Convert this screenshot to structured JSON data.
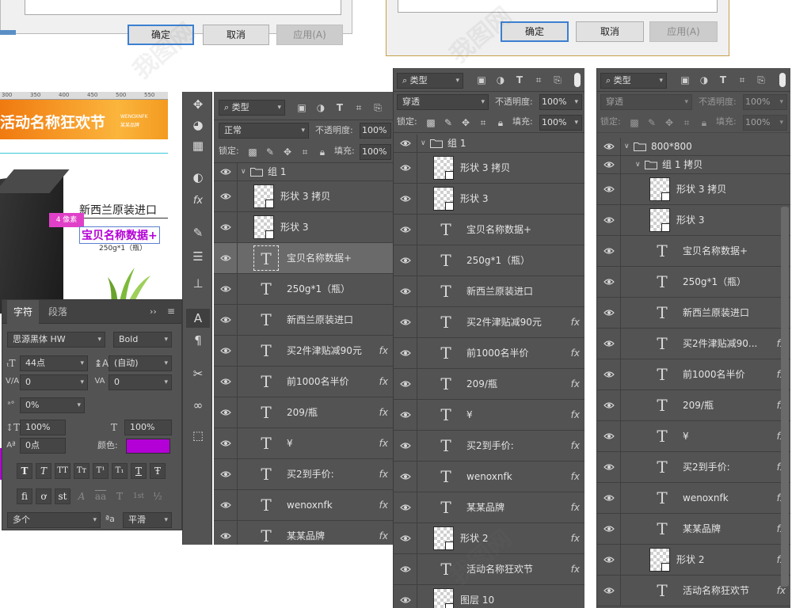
{
  "dialog_left": {
    "ok_label": "确定",
    "cancel_label": "取消",
    "apply_label": "应用(A)"
  },
  "dialog_right": {
    "ok_label": "确定",
    "cancel_label": "取消",
    "apply_label": "应用(A)"
  },
  "canvas": {
    "banner_title": "活动名称狂欢节",
    "brand_small": "WENOXNFK",
    "brand_small_cn": "某某品牌",
    "origin_text": "新西兰原装进口",
    "product_data": "宝贝名称数据+",
    "spec": "250g*1（瓶）",
    "pixel_badge": "4 像素",
    "ruler_marks": [
      "300",
      "350",
      "400",
      "450",
      "500",
      "550"
    ]
  },
  "tools": [
    "move-icon",
    "palette-icon",
    "grid-icon",
    "circle-half-icon",
    "fx-icon",
    "brush-adjust-icon",
    "sliders-icon",
    "stamp-icon",
    "type-a-icon",
    "paragraph-icon",
    "tools-icon",
    "cc-icon",
    "cube-icon"
  ],
  "character_panel": {
    "tab_character": "字符",
    "tab_paragraph": "段落",
    "font_family": "思源黑体 HW",
    "font_style": "Bold",
    "font_size": "44点",
    "leading": "(自动)",
    "kerning": "0",
    "tracking": "0",
    "scale_pct": "0%",
    "vertical_scale": "100%",
    "horizontal_scale": "100%",
    "baseline_shift": "0点",
    "color_label": "颜色:",
    "color_value": "#b300d6",
    "language": "多个",
    "aa_label": "ªa",
    "antialias": "平滑",
    "style_buttons": [
      "T",
      "T",
      "TT",
      "Tт",
      "T¹",
      "T₁",
      "T",
      "Ŧ"
    ],
    "ot_buttons": [
      "fi",
      "ơ",
      "st",
      "A",
      "aa",
      "T",
      "1st",
      "½"
    ]
  },
  "layers_panel_1": {
    "filter_kind": "类型",
    "blend_mode": "正常",
    "opacity_label": "不透明度:",
    "opacity": "100%",
    "lock_label": "锁定:",
    "fill_label": "填充:",
    "fill": "100%",
    "layers": [
      {
        "type": "group",
        "name": "组 1"
      },
      {
        "type": "shape",
        "name": "形状 3 拷贝"
      },
      {
        "type": "shape",
        "name": "形状 3"
      },
      {
        "type": "text",
        "name": "宝贝名称数据+",
        "selected": true
      },
      {
        "type": "text",
        "name": "250g*1（瓶）"
      },
      {
        "type": "text",
        "name": "新西兰原装进口"
      },
      {
        "type": "text",
        "name": "买2件津贴减90元",
        "fx": "fx"
      },
      {
        "type": "text",
        "name": "前1000名半价",
        "fx": "fx"
      },
      {
        "type": "text",
        "name": "209/瓶",
        "fx": "fx"
      },
      {
        "type": "text",
        "name": "¥",
        "fx": "fx"
      },
      {
        "type": "text",
        "name": "买2到手价:",
        "fx": "fx"
      },
      {
        "type": "text",
        "name": "wenoxnfk",
        "fx": "fx"
      },
      {
        "type": "text",
        "name": "某某品牌",
        "fx": "fx"
      }
    ]
  },
  "layers_panel_2": {
    "filter_kind": "类型",
    "blend_mode": "穿透",
    "opacity_label": "不透明度:",
    "opacity": "100%",
    "lock_label": "锁定:",
    "fill_label": "填充:",
    "fill": "100%",
    "layers": [
      {
        "type": "group",
        "name": "组 1"
      },
      {
        "type": "shape",
        "name": "形状 3 拷贝"
      },
      {
        "type": "shape",
        "name": "形状 3"
      },
      {
        "type": "text",
        "name": "宝贝名称数据+"
      },
      {
        "type": "text",
        "name": "250g*1（瓶）"
      },
      {
        "type": "text",
        "name": "新西兰原装进口"
      },
      {
        "type": "text",
        "name": "买2件津贴减90元",
        "fx": "fx"
      },
      {
        "type": "text",
        "name": "前1000名半价",
        "fx": "fx"
      },
      {
        "type": "text",
        "name": "209/瓶",
        "fx": "fx"
      },
      {
        "type": "text",
        "name": "¥",
        "fx": "fx"
      },
      {
        "type": "text",
        "name": "买2到手价:",
        "fx": "fx"
      },
      {
        "type": "text",
        "name": "wenoxnfk",
        "fx": "fx"
      },
      {
        "type": "text",
        "name": "某某品牌",
        "fx": "fx"
      },
      {
        "type": "shape",
        "name": "形状 2",
        "fx": "fx"
      },
      {
        "type": "text",
        "name": "活动名称狂欢节",
        "fx": "fx"
      },
      {
        "type": "shape",
        "name": "图层 10"
      }
    ]
  },
  "layers_panel_3": {
    "filter_kind": "类型",
    "blend_mode": "穿透",
    "opacity_label": "不透明度:",
    "opacity": "100%",
    "lock_label": "锁定:",
    "fill_label": "填充:",
    "fill": "100%",
    "layers": [
      {
        "type": "group",
        "name": "800*800"
      },
      {
        "type": "group",
        "name": "组 1 拷贝"
      },
      {
        "type": "shape",
        "name": "形状 3 拷贝"
      },
      {
        "type": "shape",
        "name": "形状 3"
      },
      {
        "type": "text",
        "name": "宝贝名称数据+"
      },
      {
        "type": "text",
        "name": "250g*1（瓶）"
      },
      {
        "type": "text",
        "name": "新西兰原装进口"
      },
      {
        "type": "text",
        "name": "买2件津贴减90...",
        "fx": "fx"
      },
      {
        "type": "text",
        "name": "前1000名半价",
        "fx": "fx"
      },
      {
        "type": "text",
        "name": "209/瓶",
        "fx": "fx"
      },
      {
        "type": "text",
        "name": "¥",
        "fx": "fx"
      },
      {
        "type": "text",
        "name": "买2到手价:",
        "fx": "fx"
      },
      {
        "type": "text",
        "name": "wenoxnfk",
        "fx": "fx"
      },
      {
        "type": "text",
        "name": "某某品牌",
        "fx": "fx"
      },
      {
        "type": "shape",
        "name": "形状 2",
        "fx": "fx"
      },
      {
        "type": "text",
        "name": "活动名称狂欢节",
        "fx": "fx"
      }
    ]
  }
}
